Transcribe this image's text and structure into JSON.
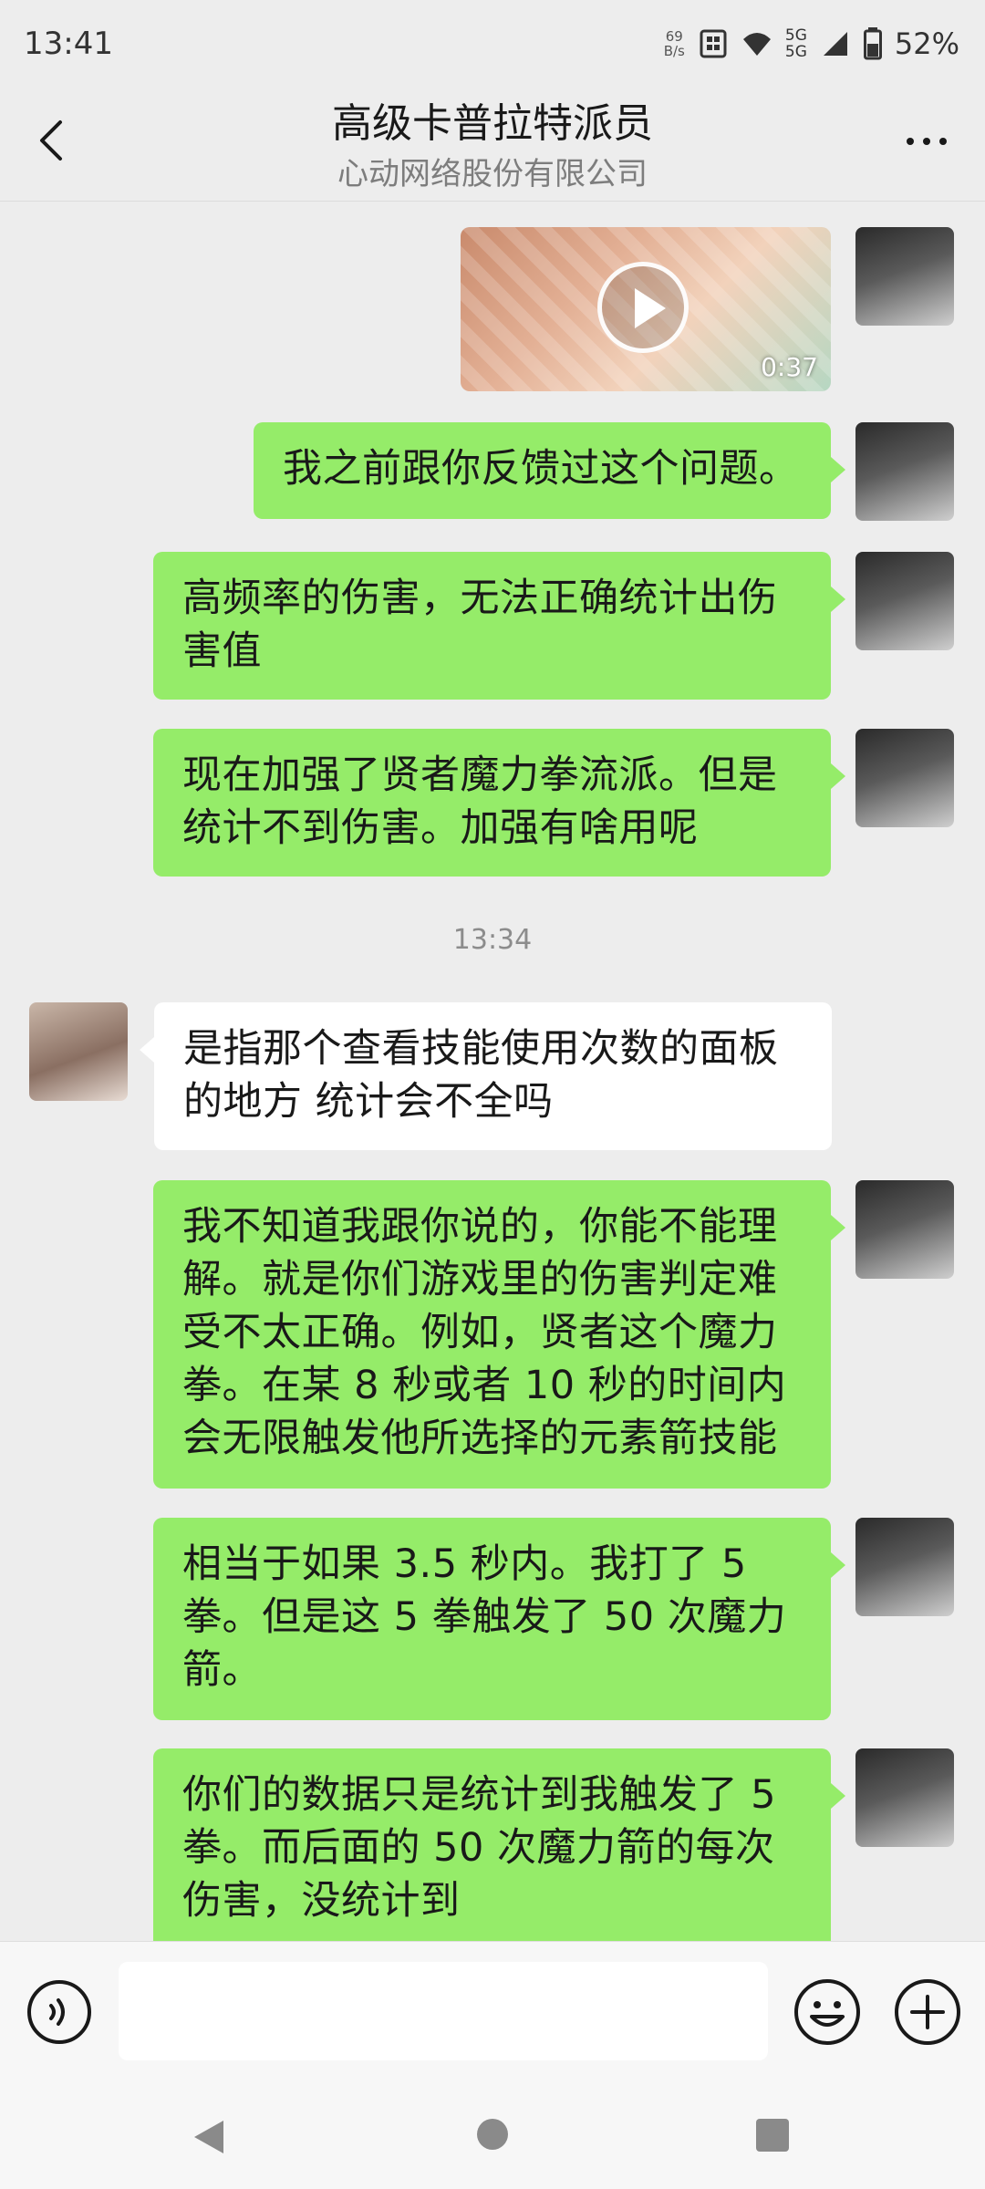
{
  "status": {
    "time": "13:41",
    "net_speed_value": "69",
    "net_speed_unit": "B/s",
    "battery": "52%",
    "network": "5G"
  },
  "header": {
    "title": "高级卡普拉特派员",
    "subtitle": "心动网络股份有限公司"
  },
  "messages": [
    {
      "sender": "me",
      "type": "video",
      "duration": "0:37"
    },
    {
      "sender": "me",
      "text": "我之前跟你反馈过这个问题。"
    },
    {
      "sender": "me",
      "text": "高频率的伤害，无法正确统计出伤害值"
    },
    {
      "sender": "me",
      "text": "现在加强了贤者魔力拳流派。但是统计不到伤害。加强有啥用呢"
    },
    {
      "sender": "system",
      "time": "13:34"
    },
    {
      "sender": "other",
      "text": "是指那个查看技能使用次数的面板的地方 统计会不全吗"
    },
    {
      "sender": "me",
      "text": "我不知道我跟你说的，你能不能理解。就是你们游戏里的伤害判定难受不太正确。例如，贤者这个魔力拳。在某 8 秒或者 10 秒的时间内会无限触发他所选择的元素箭技能"
    },
    {
      "sender": "me",
      "text": "相当于如果 3.5 秒内。我打了 5 拳。但是这 5 拳触发了 50 次魔力箭。"
    },
    {
      "sender": "me",
      "text": "你们的数据只是统计到我触发了 5 拳。而后面的 50 次魔力箭的每次伤害，没统计到"
    }
  ],
  "input": {
    "value": "",
    "placeholder": ""
  },
  "colors": {
    "my_bubble": "#95ec69",
    "other_bubble": "#ffffff",
    "background": "#ededed"
  }
}
